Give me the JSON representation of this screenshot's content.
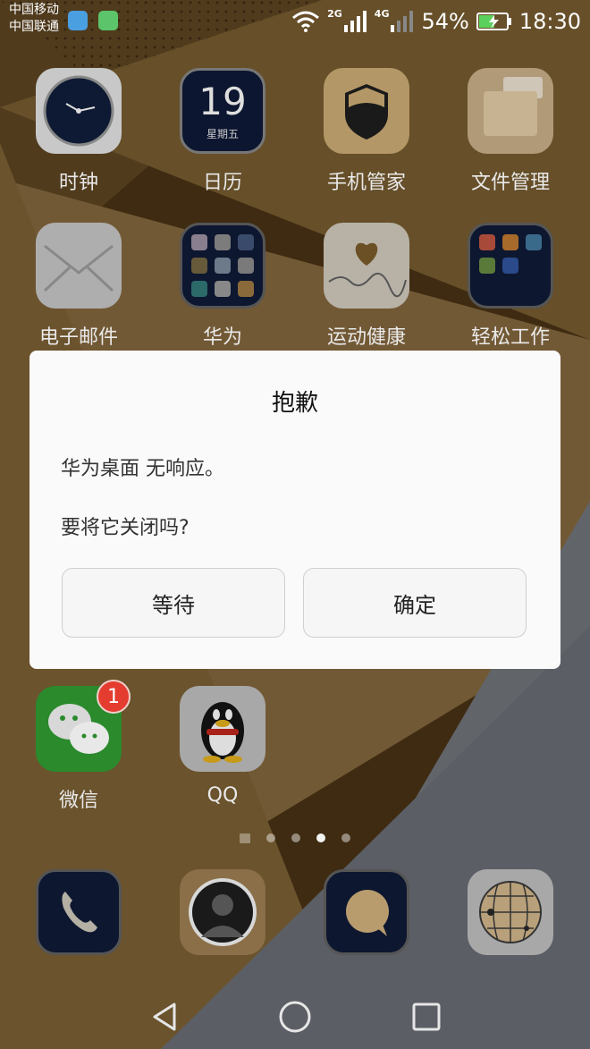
{
  "status_bar": {
    "carrier_1": "中国移动",
    "carrier_2": "中国联通",
    "net_1": "2G",
    "net_2": "4G",
    "battery": "54%",
    "time": "18:30"
  },
  "apps": [
    {
      "label": "时钟",
      "icon": "clock-icon"
    },
    {
      "label": "日历",
      "icon": "calendar-icon"
    },
    {
      "label": "手机管家",
      "icon": "shield-icon"
    },
    {
      "label": "文件管理",
      "icon": "folder-icon"
    },
    {
      "label": "电子邮件",
      "icon": "mail-icon"
    },
    {
      "label": "华为",
      "icon": "folder-grid-icon"
    },
    {
      "label": "运动健康",
      "icon": "heart-icon"
    },
    {
      "label": "轻松工作",
      "icon": "folder-grid-icon"
    },
    {
      "label": "微信",
      "icon": "wechat-icon"
    },
    {
      "label": "QQ",
      "icon": "penguin-icon"
    }
  ],
  "calendar_tile": {
    "day": "19",
    "weekday": "星期五"
  },
  "wechat_badge": "1",
  "dock": [
    "phone-icon",
    "contacts-icon",
    "message-icon",
    "browser-icon"
  ],
  "dialog": {
    "title": "抱歉",
    "message": "华为桌面 无响应。",
    "question": "要将它关闭吗?",
    "wait_label": "等待",
    "confirm_label": "确定"
  },
  "colors": {
    "wallpaper_tan": "#c49a5c",
    "wallpaper_dark": "#5a3f18",
    "wallpaper_grey": "#a8acb6",
    "badge_red": "#e43c2f",
    "wechat_green": "#3bb43a"
  }
}
